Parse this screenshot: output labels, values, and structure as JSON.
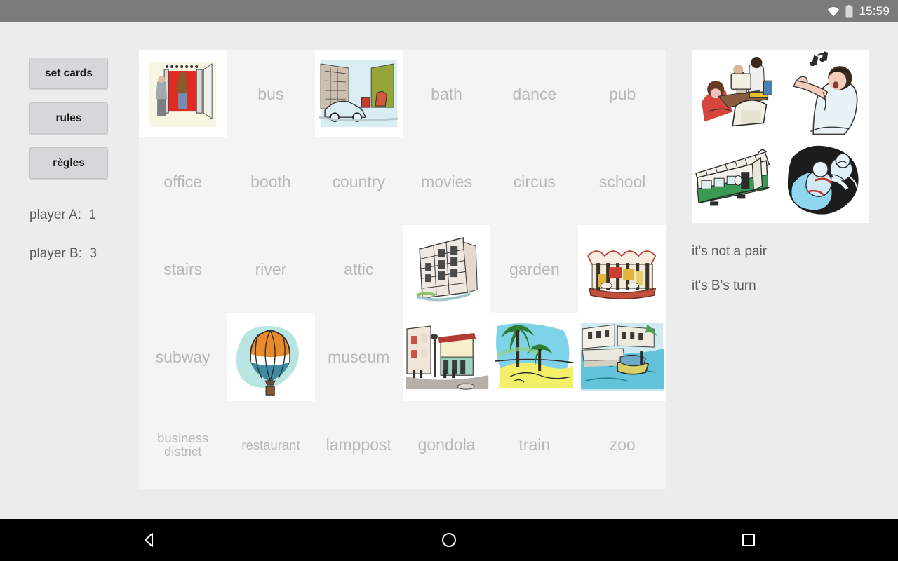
{
  "statusbar": {
    "time": "15:59",
    "wifi_icon": "wifi-icon",
    "battery_icon": "battery-icon"
  },
  "sidebar": {
    "buttons": [
      {
        "label": "set cards",
        "name": "set-cards-button"
      },
      {
        "label": "rules",
        "name": "rules-button"
      },
      {
        "label": "règles",
        "name": "regles-button"
      }
    ],
    "scores": [
      {
        "label": "player A:  1",
        "player": "player A",
        "value": "1"
      },
      {
        "label": "player B:  3",
        "player": "player B",
        "value": "3"
      }
    ]
  },
  "board": {
    "columns": 6,
    "rows": 5,
    "cells": [
      {
        "type": "image",
        "art": "elevator",
        "name": "card-elevator"
      },
      {
        "type": "word",
        "label": "bus",
        "name": "card-bus"
      },
      {
        "type": "image",
        "art": "street-car",
        "name": "card-street-car"
      },
      {
        "type": "word",
        "label": "bath",
        "name": "card-bath"
      },
      {
        "type": "word",
        "label": "dance",
        "name": "card-dance"
      },
      {
        "type": "word",
        "label": "pub",
        "name": "card-pub"
      },
      {
        "type": "word",
        "label": "office",
        "name": "card-office"
      },
      {
        "type": "word",
        "label": "booth",
        "name": "card-booth"
      },
      {
        "type": "word",
        "label": "country",
        "name": "card-country"
      },
      {
        "type": "word",
        "label": "movies",
        "name": "card-movies"
      },
      {
        "type": "word",
        "label": "circus",
        "name": "card-circus"
      },
      {
        "type": "word",
        "label": "school",
        "name": "card-school"
      },
      {
        "type": "word",
        "label": "stairs",
        "name": "card-stairs"
      },
      {
        "type": "word",
        "label": "river",
        "name": "card-river"
      },
      {
        "type": "word",
        "label": "attic",
        "name": "card-attic"
      },
      {
        "type": "image",
        "art": "apartment-building",
        "name": "card-apartment-building"
      },
      {
        "type": "word",
        "label": "garden",
        "name": "card-garden"
      },
      {
        "type": "image",
        "art": "carousel",
        "name": "card-carousel"
      },
      {
        "type": "word",
        "label": "subway",
        "name": "card-subway"
      },
      {
        "type": "image",
        "art": "hot-air-balloon",
        "name": "card-hot-air-balloon"
      },
      {
        "type": "word",
        "label": "museum",
        "name": "card-museum"
      },
      {
        "type": "image",
        "art": "street-corner",
        "name": "card-street-corner"
      },
      {
        "type": "image",
        "art": "beach",
        "name": "card-beach"
      },
      {
        "type": "image",
        "art": "canal-boats",
        "name": "card-canal-boats"
      },
      {
        "type": "word",
        "label": "business district",
        "name": "card-business-district",
        "size": "small"
      },
      {
        "type": "word",
        "label": "restaurant",
        "name": "card-restaurant",
        "size": "small"
      },
      {
        "type": "word",
        "label": "lamppost",
        "name": "card-lamppost"
      },
      {
        "type": "word",
        "label": "gondola",
        "name": "card-gondola"
      },
      {
        "type": "word",
        "label": "train",
        "name": "card-train"
      },
      {
        "type": "word",
        "label": "zoo",
        "name": "card-zoo"
      }
    ]
  },
  "right_panel": {
    "pair_images": [
      {
        "art": "office-workers",
        "name": "pair-image-office-workers"
      },
      {
        "art": "opera-singer",
        "name": "pair-image-opera-singer"
      },
      {
        "art": "tram",
        "name": "pair-image-tram"
      },
      {
        "art": "astronauts",
        "name": "pair-image-astronauts"
      }
    ],
    "messages": [
      "it's not a pair",
      "it's B's turn"
    ]
  },
  "navbar": {
    "back_icon": "back-triangle-icon",
    "home_icon": "home-circle-icon",
    "recents_icon": "recents-square-icon"
  },
  "colors": {
    "statusbar_bg": "#7b7b7b",
    "app_bg": "#ececec",
    "board_bg": "#f4f4f4",
    "word_color": "#b9b9b9",
    "text_color": "#5c5c5c",
    "button_bg": "#d6d7d9",
    "navbar_bg": "#000000"
  }
}
